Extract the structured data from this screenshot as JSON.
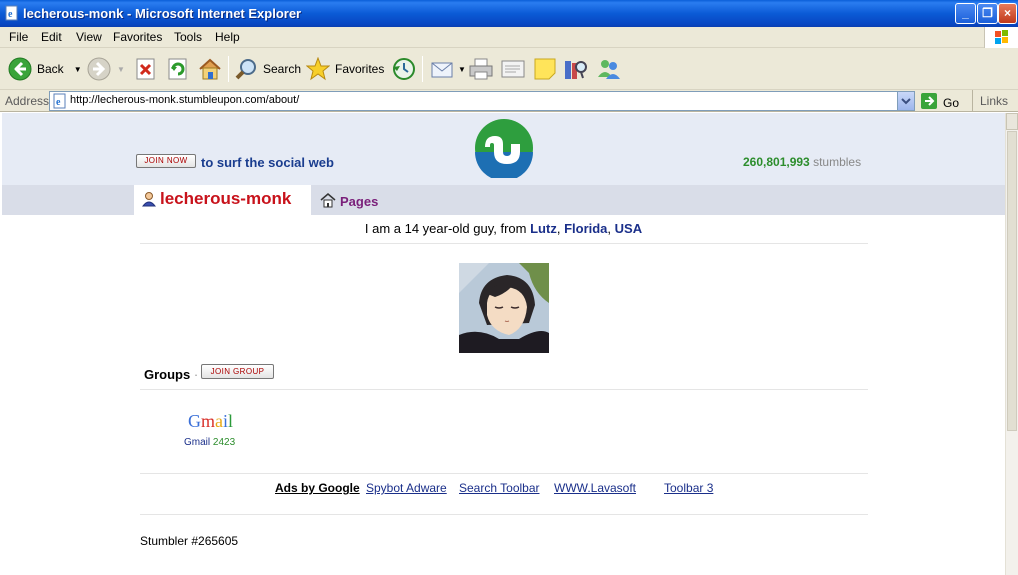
{
  "window": {
    "title": "lecherous-monk - Microsoft Internet Explorer"
  },
  "menu": {
    "items": [
      "File",
      "Edit",
      "View",
      "Favorites",
      "Tools",
      "Help"
    ]
  },
  "toolbar": {
    "back_label": "Back",
    "search_label": "Search",
    "favorites_label": "Favorites"
  },
  "address": {
    "label": "Address",
    "url": "http://lecherous-monk.stumbleupon.com/about/",
    "go_label": "Go",
    "links_label": "Links"
  },
  "page": {
    "join_now_label": "JOIN NOW",
    "surf_text": "to surf the social web",
    "stumbles_count": "260,801,993",
    "stumbles_label": "stumbles",
    "username": "lecherous-monk",
    "pages_tab": "Pages",
    "bio_prefix": "I am a 14 year-old guy, from",
    "location_city": "Lutz",
    "location_state": "Florida",
    "location_country": "USA",
    "groups_label": "Groups",
    "join_group_label": "JOIN GROUP",
    "group_name": "Gmail",
    "group_count": "2423",
    "ads_title": "Ads by Google",
    "ads": [
      "Spybot Adware",
      "Search Toolbar",
      "WWW.Lavasoft",
      "Toolbar 3"
    ],
    "stumbler_number": "Stumbler #265605"
  },
  "colors": {
    "titlebar": "#0a5fd8",
    "chrome": "#ece9d8",
    "su_header": "#e6ebf5",
    "username": "#c8121b",
    "link_blue": "#1a2f8a",
    "stumbles_green": "#2c8d2c"
  }
}
